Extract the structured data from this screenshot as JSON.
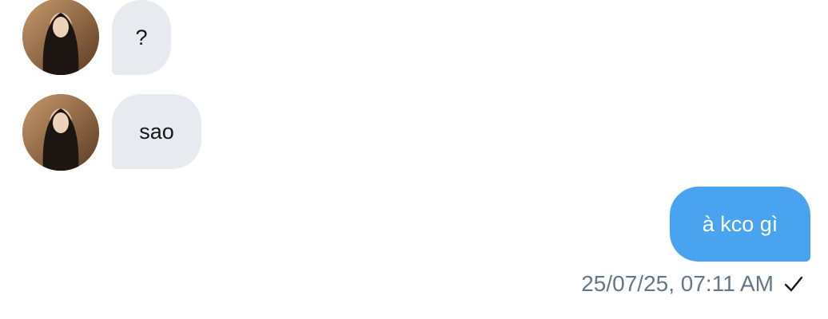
{
  "messages": [
    {
      "direction": "incoming",
      "text": "?"
    },
    {
      "direction": "incoming",
      "text": "sao"
    },
    {
      "direction": "outgoing",
      "text": "à kco gì"
    }
  ],
  "last_message_meta": {
    "timestamp": "25/07/25, 07:11 AM",
    "status_icon": "check-icon"
  },
  "colors": {
    "incoming_bubble": "#e7ebef",
    "outgoing_bubble": "#4aa3ee",
    "meta_text": "#657786"
  }
}
